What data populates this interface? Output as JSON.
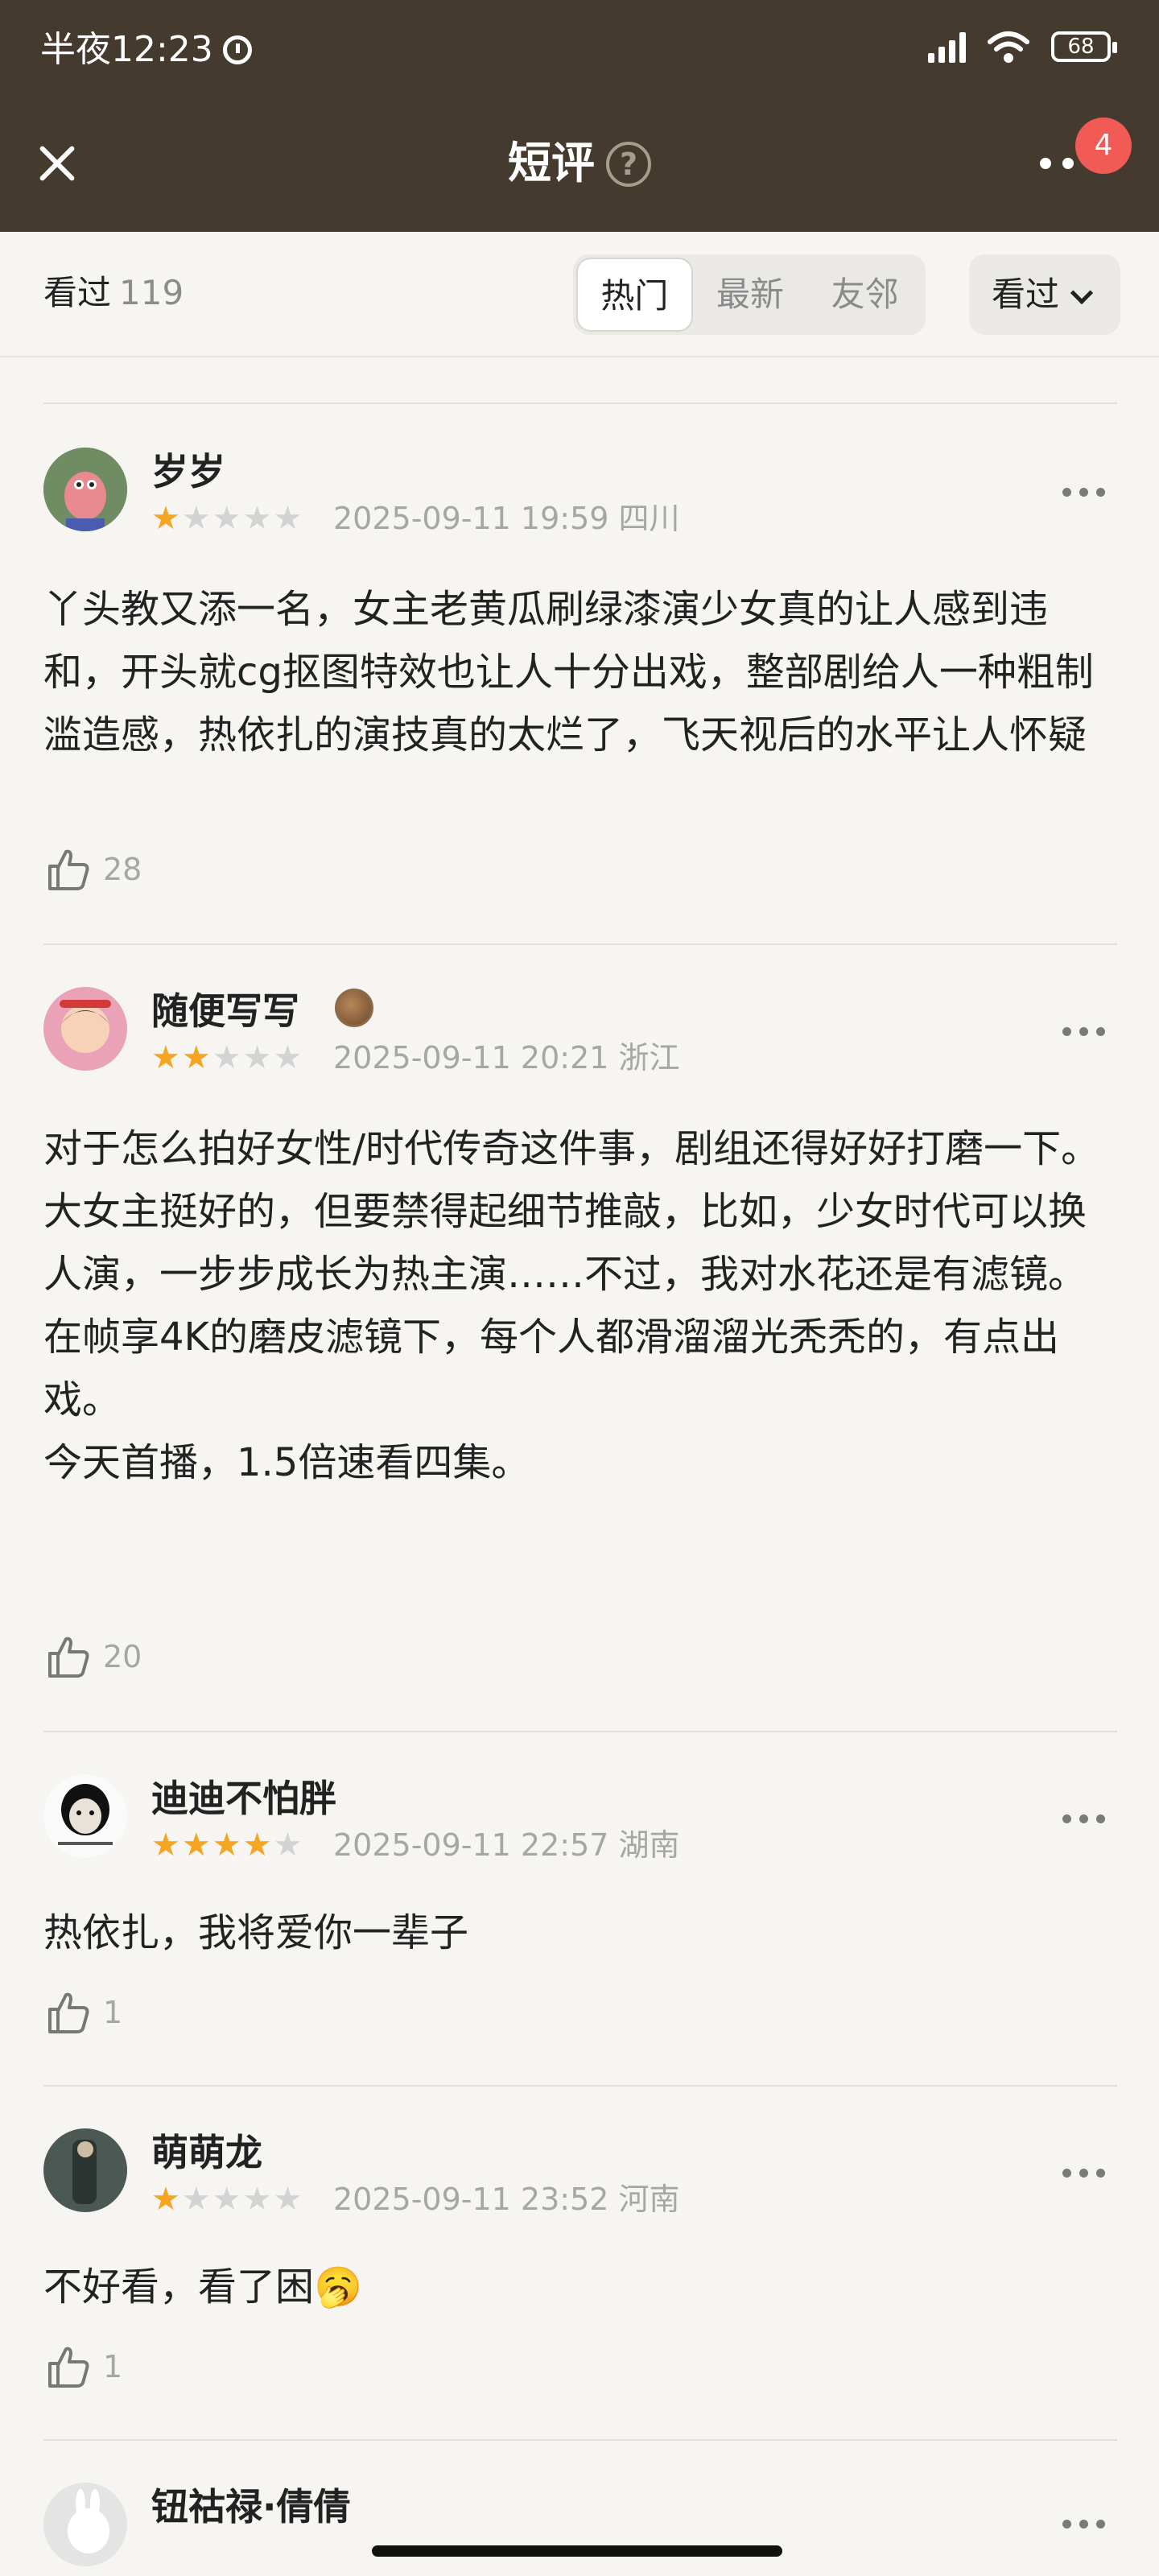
{
  "status_bar": {
    "time": "半夜12:23",
    "battery": "68"
  },
  "nav": {
    "title": "短评",
    "help_glyph": "?",
    "notification_count": "4"
  },
  "filter": {
    "seen_label": "看过",
    "seen_count": "119",
    "tabs": [
      {
        "label": "热门",
        "active": true
      },
      {
        "label": "最新",
        "active": false
      },
      {
        "label": "友邻",
        "active": false
      }
    ],
    "dropdown_label": "看过"
  },
  "reviews": [
    {
      "username": "岁岁",
      "rating": 1,
      "date": "2025-09-11 19:59",
      "location": "四川",
      "text": "丫头教又添一名，女主老黄瓜刷绿漆演少女真的让人感到违和，开头就cg抠图特效也让人十分出戏，整部剧给人一种粗制滥造感，热依扎的演技真的太烂了，飞天视后的水平让人怀疑",
      "likes": "28"
    },
    {
      "username": "随便写写",
      "rating": 2,
      "date": "2025-09-11 20:21",
      "location": "浙江",
      "text": "对于怎么拍好女性/时代传奇这件事，剧组还得好好打磨一下。\n大女主挺好的，但要禁得起细节推敲，比如，少女时代可以换人演，一步步成长为热主演……不过，我对水花还是有滤镜。\n在帧享4K的磨皮滤镜下，每个人都滑溜溜光秃秃的，有点出戏。\n今天首播，1.5倍速看四集。",
      "likes": "20"
    },
    {
      "username": "迪迪不怕胖",
      "rating": 4,
      "date": "2025-09-11 22:57",
      "location": "湖南",
      "text": "热依扎，我将爱你一辈子",
      "likes": "1"
    },
    {
      "username": "萌萌龙",
      "rating": 1,
      "date": "2025-09-11 23:52",
      "location": "河南",
      "text": "不好看，看了困🥱",
      "likes": "1"
    },
    {
      "username": "钮祜禄·倩倩"
    }
  ],
  "colors": {
    "header_bg": "#453a2e",
    "page_bg": "#f6f5f2",
    "star_on": "#f4a623",
    "star_off": "#d3d3d3",
    "badge_red": "#f25a55"
  }
}
